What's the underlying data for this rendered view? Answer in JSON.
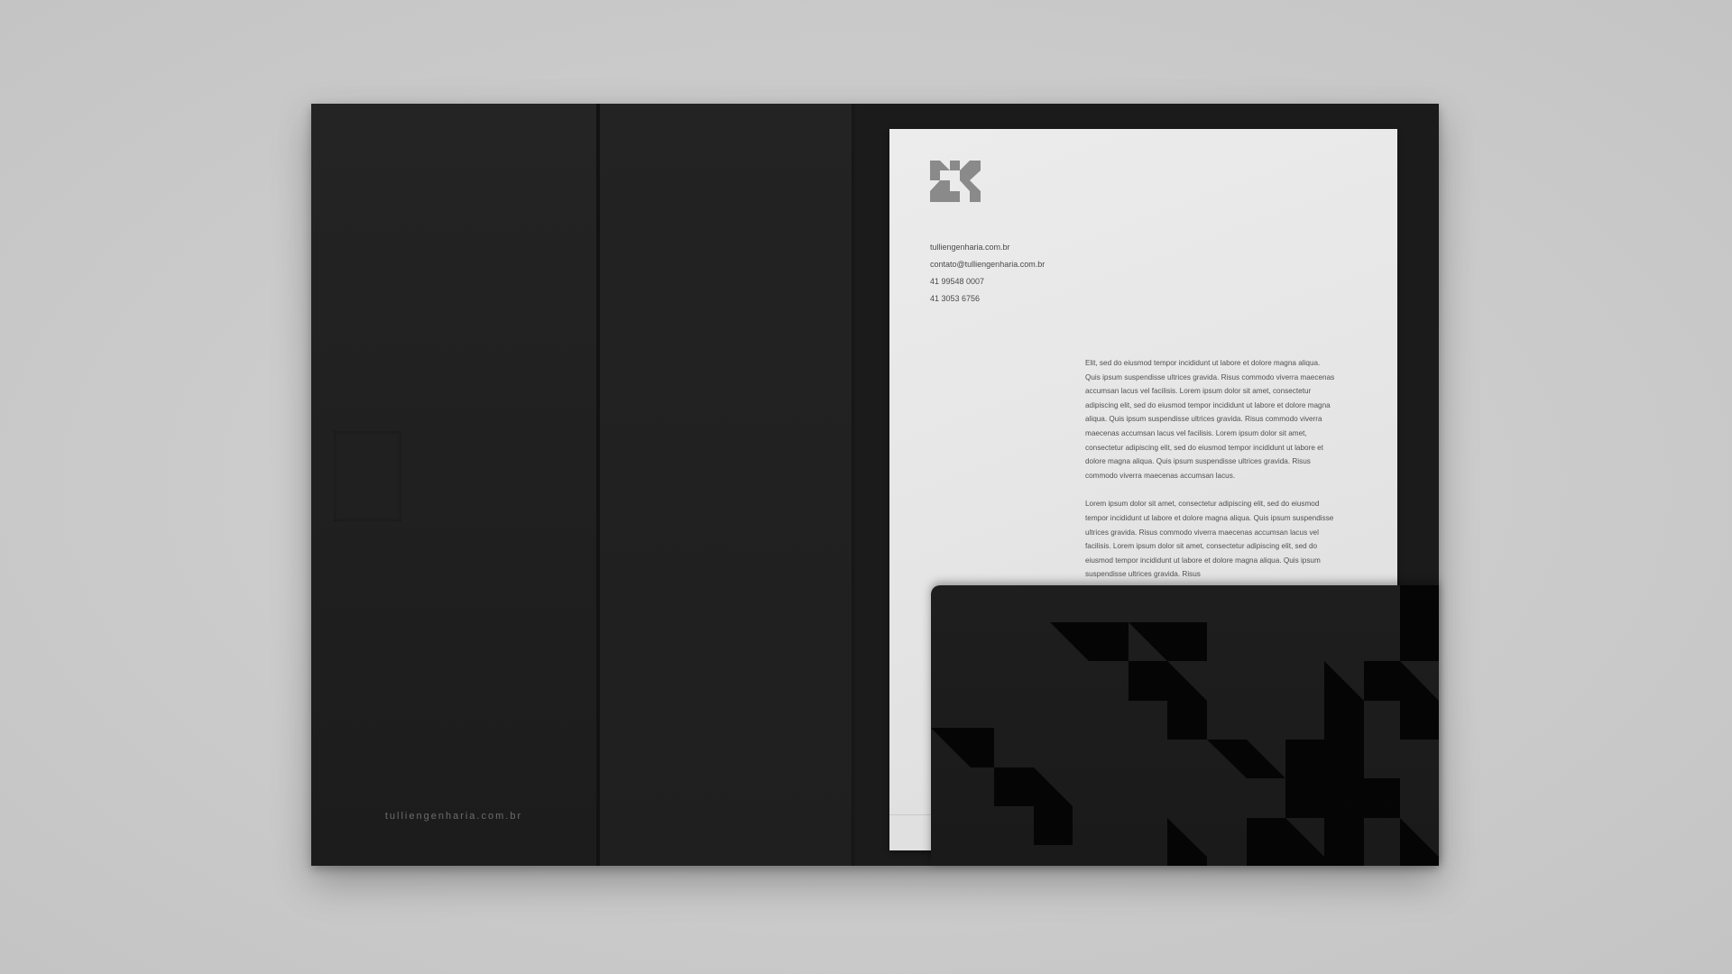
{
  "scene": {
    "background_color": "#cbcbcb",
    "folder_color": "#1f1f1f",
    "paper_color": "#e8e8e8"
  },
  "cover": {
    "url": "tulliengenharia.com.br"
  },
  "letterhead": {
    "logo_icon": "tulli-logo-icon",
    "contact": {
      "website": "tulliengenharia.com.br",
      "email": "contato@tulliengenharia.com.br",
      "phone_1": "41 99548 0007",
      "phone_2": "41 3053 6756"
    },
    "body": {
      "paragraph_1": "Elit, sed do eiusmod tempor incididunt ut labore et dolore magna aliqua. Quis ipsum suspendisse ultrices gravida. Risus commodo viverra maecenas accumsan lacus vel facilisis.  Lorem ipsum dolor sit amet, consectetur adipiscing elit, sed do eiusmod tempor incididunt ut labore et dolore magna aliqua. Quis ipsum suspendisse ultrices gravida. Risus commodo viverra maecenas accumsan lacus vel facilisis. Lorem ipsum dolor sit amet, consectetur adipiscing elit, sed do eiusmod tempor incididunt ut labore et dolore magna aliqua. Quis ipsum suspendisse ultrices gravida. Risus commodo viverra maecenas accumsan lacus.",
      "paragraph_2": "Lorem ipsum dolor sit amet, consectetur adipiscing elit, sed do eiusmod tempor incididunt ut labore et dolore magna aliqua. Quis ipsum suspendisse ultrices gravida. Risus commodo viverra maecenas accumsan lacus vel facilisis. Lorem ipsum dolor sit amet, consectetur adipiscing elit, sed do eiusmod tempor incididunt ut labore et dolore magna aliqua. Quis ipsum suspendisse ultrices gravida. Risus"
    }
  },
  "pocket": {
    "pattern_icon": "geometric-triangle-pattern",
    "pattern_color": "#050505"
  }
}
